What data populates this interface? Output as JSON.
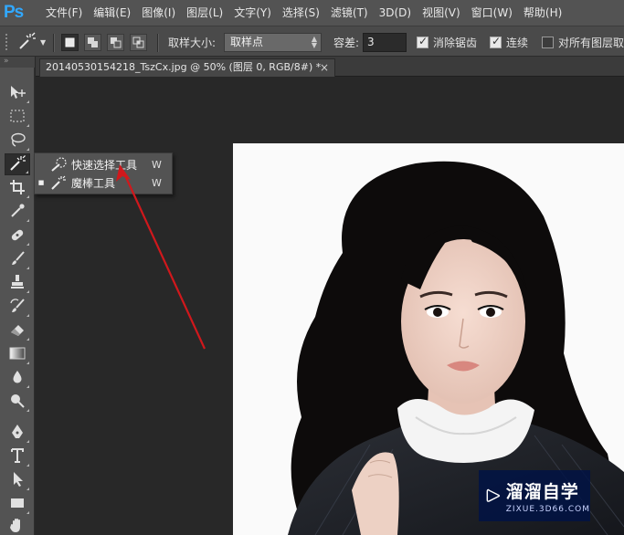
{
  "app": {
    "logo": "Ps"
  },
  "menu": [
    "文件(F)",
    "编辑(E)",
    "图像(I)",
    "图层(L)",
    "文字(Y)",
    "选择(S)",
    "滤镜(T)",
    "3D(D)",
    "视图(V)",
    "窗口(W)",
    "帮助(H)"
  ],
  "options": {
    "sample_size_label": "取样大小:",
    "sample_size_value": "取样点",
    "tolerance_label": "容差:",
    "tolerance_value": "3",
    "antialias_label": "消除锯齿",
    "antialias_checked": true,
    "contiguous_label": "连续",
    "contiguous_checked": true,
    "sample_all_label": "对所有图层取",
    "sample_all_checked": false
  },
  "toolbox": {
    "grip": "»",
    "tools": [
      {
        "name": "move-tool",
        "icon": "move-icon"
      },
      {
        "name": "marquee-tool",
        "icon": "rect-marquee-icon"
      },
      {
        "name": "lasso-tool",
        "icon": "lasso-icon"
      },
      {
        "name": "magic-wand-tool",
        "icon": "magic-wand-icon",
        "active": true
      },
      {
        "name": "crop-tool",
        "icon": "crop-icon"
      },
      {
        "name": "eyedropper-tool",
        "icon": "eyedropper-icon"
      },
      {
        "name": "healing-brush-tool",
        "icon": "bandage-icon"
      },
      {
        "name": "brush-tool",
        "icon": "brush-icon"
      },
      {
        "name": "clone-stamp-tool",
        "icon": "stamp-icon"
      },
      {
        "name": "history-brush-tool",
        "icon": "history-brush-icon"
      },
      {
        "name": "eraser-tool",
        "icon": "eraser-icon"
      },
      {
        "name": "gradient-tool",
        "icon": "gradient-icon"
      },
      {
        "name": "blur-tool",
        "icon": "drop-icon"
      },
      {
        "name": "dodge-tool",
        "icon": "dodge-icon"
      },
      {
        "name": "pen-tool",
        "icon": "pen-icon"
      },
      {
        "name": "type-tool",
        "icon": "type-icon"
      },
      {
        "name": "path-selection-tool",
        "icon": "arrow-cursor-icon"
      },
      {
        "name": "shape-tool",
        "icon": "rectangle-icon"
      },
      {
        "name": "hand-tool",
        "icon": "hand-icon"
      }
    ]
  },
  "document": {
    "tab_title": "20140530154218_TszCx.jpg @ 50% (图层 0, RGB/8#) *",
    "close_glyph": "×"
  },
  "flyout": {
    "items": [
      {
        "label": "快速选择工具",
        "shortcut": "W",
        "icon": "quick-selection-icon",
        "current": false
      },
      {
        "label": "魔棒工具",
        "shortcut": "W",
        "icon": "magic-wand-icon",
        "current": true
      }
    ]
  },
  "watermark": {
    "title": "溜溜自学",
    "subtitle": "ZIXUE.3D66.COM"
  },
  "colors": {
    "menubar": "#535353",
    "canvas": "#282828",
    "arrow": "#d0181c",
    "ps_blue": "#31a8ff"
  }
}
